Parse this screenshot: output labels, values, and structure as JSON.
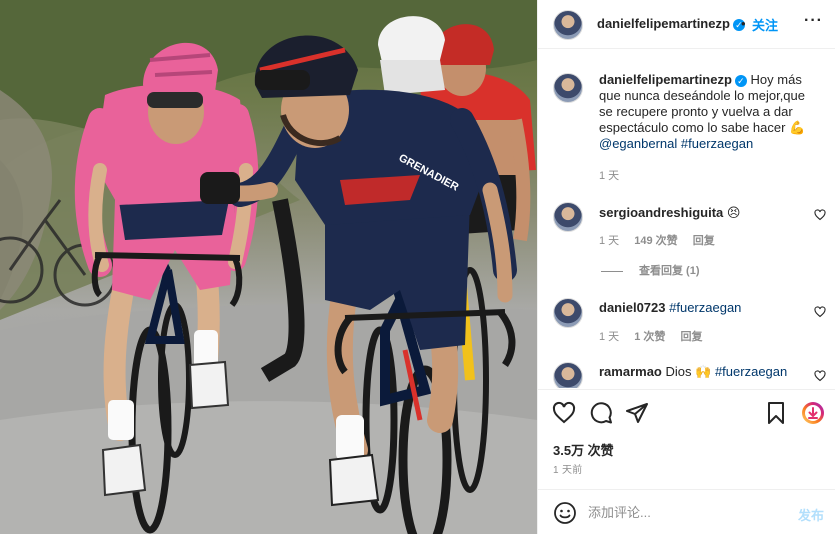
{
  "post": {
    "author": "danielfelipemartinezp",
    "dot": "•",
    "follow_label": "关注",
    "more_label": "···",
    "caption": {
      "text": "Hoy más que nunca deseándole lo mejor,que se recupere pronto y vuelva a dar espectáculo como lo sabe hacer",
      "emoji": "💪",
      "mention": "@eganbernal",
      "hashtag": "#fuerzaegan",
      "time": "1 天"
    },
    "comments": [
      {
        "username": "sergioandreshiguita",
        "text": "",
        "emoji": "😣",
        "time": "1 天",
        "likes": "149 次赞",
        "reply_label": "回复",
        "view_replies": "查看回复 (1)"
      },
      {
        "username": "daniel0723",
        "text": "#fuerzaegan",
        "time": "1 天",
        "likes": "1 次赞",
        "reply_label": "回复"
      },
      {
        "username": "ramarmao",
        "text": "Dios",
        "emoji": "🙌",
        "hashtag": "#fuerzaegan"
      }
    ],
    "likes_count": "3.5万 次赞",
    "posted_ago": "1 天前",
    "comment_placeholder": "添加评论...",
    "post_label": "发布"
  },
  "icons": {
    "like": "heart-icon",
    "comment": "comment-icon",
    "share": "share-icon",
    "save": "bookmark-icon",
    "emoji": "emoji-icon",
    "verified": "verified-badge-icon"
  },
  "colors": {
    "accent": "#0095f6",
    "link": "#00376b",
    "muted": "#8e8e8e",
    "post_disabled": "#b2dffc",
    "jersey_pink": "#e9629a",
    "jersey_navy": "#1d2a4d",
    "jersey_red": "#d9312b"
  }
}
